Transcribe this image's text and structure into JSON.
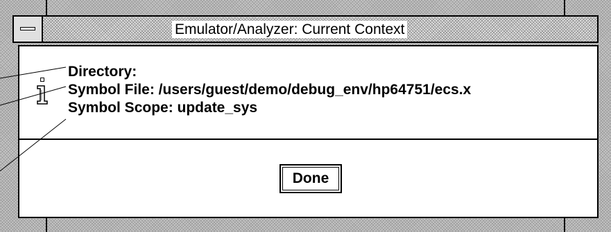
{
  "window": {
    "title": "Emulator/Analyzer: Current Context"
  },
  "dialog": {
    "icon": "information-icon",
    "directory_line": "Directory:",
    "symbol_file_line": "Symbol File: /users/guest/demo/debug_env/hp64751/ecs.x",
    "symbol_scope_line": "Symbol Scope: update_sys",
    "done_label": "Done"
  },
  "colors": {
    "frame": "#c8c8c8",
    "background": "#ffffff",
    "text": "#000000"
  }
}
